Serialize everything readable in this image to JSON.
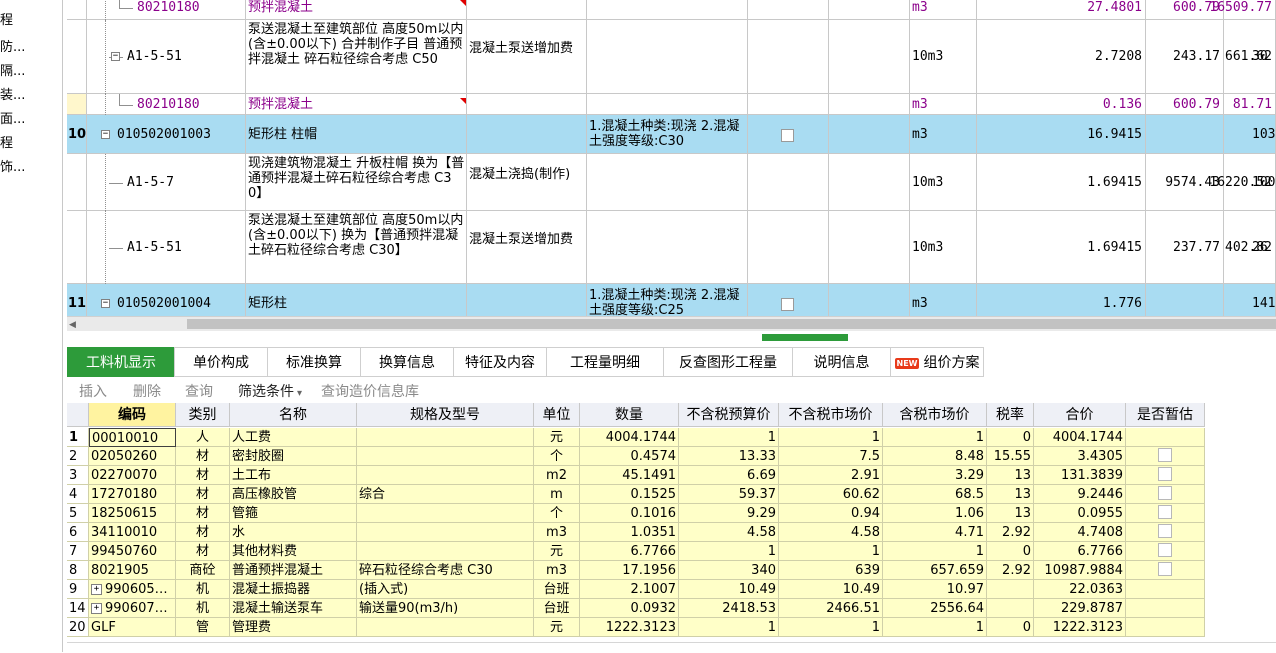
{
  "left_tree": [
    "程",
    "防...",
    "隔...",
    "装...",
    "面...",
    "程",
    "饰..."
  ],
  "upper_rows": [
    {
      "kind": "child",
      "code": "80210180",
      "name": "预拌混凝土",
      "work": "",
      "feature": "",
      "unit": "m3",
      "qty": "27.4801",
      "price": "600.79",
      "total": "16509.77",
      "extra": "",
      "purple": true,
      "red_mark": true
    },
    {
      "kind": "sub",
      "code": "A1-5-51",
      "name": "泵送混凝土至建筑部位 高度50m以内(含±0.00以下) 合并制作子目 普通预拌混凝土 碎石粒径综合考虑 C50",
      "work": "混凝土泵送增加费",
      "feature": "",
      "unit": "10m3",
      "qty": "2.7208",
      "price": "243.17",
      "total": "661.62",
      "extra": "30",
      "purple": false,
      "expand": "−"
    },
    {
      "kind": "child",
      "code": "80210180",
      "name": "预拌混凝土",
      "work": "",
      "feature": "",
      "unit": "m3",
      "qty": "0.136",
      "price": "600.79",
      "total": "81.71",
      "extra": "",
      "purple": true,
      "red_mark": true
    },
    {
      "kind": "main",
      "num": "10",
      "code": "010502001003",
      "name": "矩形柱 柱帽",
      "work": "",
      "feature": "1.混凝土种类:现浇 2.混凝土强度等级:C30",
      "unit": "m3",
      "qty": "16.9415",
      "price": "",
      "total": "",
      "extra": "103",
      "purple": false,
      "expand": "−"
    },
    {
      "kind": "sub",
      "code": "A1-5-7",
      "name": "现浇建筑物混凝土 升板柱帽 换为【普通预拌混凝土碎石粒径综合考虑 C30】",
      "work": "混凝土浇捣(制作)",
      "feature": "",
      "unit": "10m3",
      "qty": "1.69415",
      "price": "9574.43",
      "total": "16220.52",
      "extra": "100",
      "purple": false
    },
    {
      "kind": "sub",
      "code": "A1-5-51",
      "name": "泵送混凝土至建筑部位 高度50m以内(含±0.00以下) 换为【普通预拌混凝土碎石粒径综合考虑 C30】",
      "work": "混凝土泵送增加费",
      "feature": "",
      "unit": "10m3",
      "qty": "1.69415",
      "price": "237.77",
      "total": "402.82",
      "extra": "26",
      "purple": false
    },
    {
      "kind": "main",
      "num": "11",
      "code": "010502001004",
      "name": "矩形柱",
      "work": "",
      "feature": "1.混凝土种类:现浇 2.混凝土强度等级:C25",
      "unit": "m3",
      "qty": "1.776",
      "price": "",
      "total": "",
      "extra": "141",
      "purple": false,
      "expand": "−"
    }
  ],
  "tabs": [
    "工料机显示",
    "单价构成",
    "标准换算",
    "换算信息",
    "特征及内容",
    "工程量明细",
    "反查图形工程量",
    "说明信息",
    "组价方案"
  ],
  "tab_badge": "NEW",
  "toolbar": {
    "insert": "插入",
    "delete": "删除",
    "query": "查询",
    "filter": "筛选条件",
    "filter_arrow": "▾",
    "price_query": "查询造价信息库"
  },
  "bottom_headers": [
    "编码",
    "类别",
    "名称",
    "规格及型号",
    "单位",
    "数量",
    "不含税预算价",
    "不含税市场价",
    "含税市场价",
    "税率",
    "合价",
    "是否暂估"
  ],
  "bottom_rows": [
    {
      "n": "1",
      "expand": "",
      "code": "00010010",
      "type": "人",
      "name": "人工费",
      "spec": "",
      "unit": "元",
      "qty": "4004.1744",
      "budget": "1",
      "market": "1",
      "tax_market": "1",
      "rate": "0",
      "total": "4004.1744",
      "est": false
    },
    {
      "n": "2",
      "expand": "",
      "code": "02050260",
      "type": "材",
      "name": "密封胶圈",
      "spec": "",
      "unit": "个",
      "qty": "0.4574",
      "budget": "13.33",
      "market": "7.5",
      "tax_market": "8.48",
      "rate": "15.55",
      "total": "3.4305",
      "est": true
    },
    {
      "n": "3",
      "expand": "",
      "code": "02270070",
      "type": "材",
      "name": "土工布",
      "spec": "",
      "unit": "m2",
      "qty": "45.1491",
      "budget": "6.69",
      "market": "2.91",
      "tax_market": "3.29",
      "rate": "13",
      "total": "131.3839",
      "est": true
    },
    {
      "n": "4",
      "expand": "",
      "code": "17270180",
      "type": "材",
      "name": "高压橡胶管",
      "spec": "综合",
      "unit": "m",
      "qty": "0.1525",
      "budget": "59.37",
      "market": "60.62",
      "tax_market": "68.5",
      "rate": "13",
      "total": "9.2446",
      "est": true
    },
    {
      "n": "5",
      "expand": "",
      "code": "18250615",
      "type": "材",
      "name": "管箍",
      "spec": "",
      "unit": "个",
      "qty": "0.1016",
      "budget": "9.29",
      "market": "0.94",
      "tax_market": "1.06",
      "rate": "13",
      "total": "0.0955",
      "est": true
    },
    {
      "n": "6",
      "expand": "",
      "code": "34110010",
      "type": "材",
      "name": "水",
      "spec": "",
      "unit": "m3",
      "qty": "1.0351",
      "budget": "4.58",
      "market": "4.58",
      "tax_market": "4.71",
      "rate": "2.92",
      "total": "4.7408",
      "est": true
    },
    {
      "n": "7",
      "expand": "",
      "code": "99450760",
      "type": "材",
      "name": "其他材料费",
      "spec": "",
      "unit": "元",
      "qty": "6.7766",
      "budget": "1",
      "market": "1",
      "tax_market": "1",
      "rate": "0",
      "total": "6.7766",
      "est": true
    },
    {
      "n": "8",
      "expand": "",
      "code": "8021905",
      "type": "商砼",
      "name": "普通预拌混凝土",
      "spec": "碎石粒径综合考虑 C30",
      "unit": "m3",
      "qty": "17.1956",
      "budget": "340",
      "market": "639",
      "tax_market": "657.659",
      "rate": "2.92",
      "total": "10987.9884",
      "est": true
    },
    {
      "n": "9",
      "expand": "+",
      "code": "990605…",
      "type": "机",
      "name": "混凝土振捣器",
      "spec": "(插入式)",
      "unit": "台班",
      "qty": "2.1007",
      "budget": "10.49",
      "market": "10.49",
      "tax_market": "10.97",
      "rate": "",
      "total": "22.0363",
      "est": false
    },
    {
      "n": "14",
      "expand": "+",
      "code": "990607…",
      "type": "机",
      "name": "混凝土输送泵车",
      "spec": "输送量90(m3/h)",
      "unit": "台班",
      "qty": "0.0932",
      "budget": "2418.53",
      "market": "2466.51",
      "tax_market": "2556.64",
      "rate": "",
      "total": "229.8787",
      "est": false
    },
    {
      "n": "20",
      "expand": "",
      "code": "GLF",
      "type": "管",
      "name": "管理费",
      "spec": "",
      "unit": "元",
      "qty": "1222.3123",
      "budget": "1",
      "market": "1",
      "tax_market": "1",
      "rate": "0",
      "total": "1222.3123",
      "est": false
    }
  ]
}
